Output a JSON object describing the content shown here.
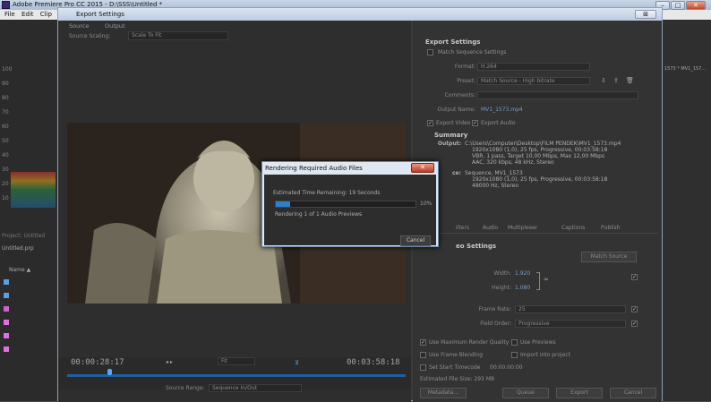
{
  "background_app": {
    "title": "Adobe Premiere Pro CC 2015 - D:\\SSS\\Untitled *",
    "menu": [
      "File",
      "Edit",
      "Clip"
    ],
    "window_controls": [
      "–",
      "□",
      "✕"
    ],
    "meter_scale": [
      "100",
      "90",
      "80",
      "70",
      "60",
      "50",
      "40",
      "30",
      "20",
      "10"
    ],
    "project": {
      "label": "Project: Untitled",
      "file": "Untitled.prp",
      "name_header": "Name ▲"
    },
    "right_seq": "1573 * MV1_157..."
  },
  "dialog": {
    "title": "Export Settings",
    "close_label": "⊠",
    "tabs": [
      "Source",
      "Output"
    ],
    "source_scaling_label": "Source Scaling:",
    "source_scaling_value": "Scale To Fit",
    "timecode_in": "00:00:28:17",
    "timecode_out": "00:03:58:18",
    "fit_value": "Fit",
    "source_range_label": "Source Range:",
    "source_range_value": "Sequence In/Out",
    "export_settings": {
      "header": "Export Settings",
      "match_sequence": "Match Sequence Settings",
      "format_label": "Format:",
      "format_value": "H.264",
      "preset_label": "Preset:",
      "preset_value": "Match Source - High bitrate",
      "comments_label": "Comments:",
      "output_name_label": "Output Name:",
      "output_name_value": "MV1_1573.mp4",
      "export_video": "Export Video",
      "export_audio": "Export Audio"
    },
    "summary": {
      "header": "Summary",
      "output_label": "Output:",
      "output_lines": [
        "C:\\Users\\Computer\\Desktop\\FILM PENDEK\\MV1_1573.mp4",
        "1920x1080 (1,0), 25 fps, Progressive, 00:03:58:18",
        "VBR, 1 pass, Target 10,00 Mbps, Max 12,00 Mbps",
        "AAC, 320 kbps, 48 kHz, Stereo"
      ],
      "source_label": "ce:",
      "source_lines": [
        "Sequence, MV1_1573",
        "1920x1080 (1,0), 25 fps, Progressive, 00:03:58:18",
        "48000 Hz, Stereo"
      ]
    },
    "settings_tabs": [
      "ilters",
      "Audio",
      "Multiplexer",
      "Captions",
      "Publish"
    ],
    "video_settings": {
      "header": "eo Settings",
      "match_source_button": "Match Source",
      "width_label": "Width:",
      "width_value": "1.920",
      "height_label": "Height:",
      "height_value": "1.080",
      "frame_rate_label": "Frame Rate:",
      "frame_rate_value": "25",
      "field_order_label": "Field Order:",
      "field_order_value": "Progressive"
    },
    "bottom": {
      "max_render_quality": "Use Maximum Render Quality",
      "use_previews": "Use Previews",
      "frame_blending": "Use Frame Blending",
      "import_into_project": "Import into project",
      "set_start_timecode": "Set Start Timecode",
      "start_timecode_value": "00:00:00:00",
      "estimated_file_size": "Estimated File Size: 293 MB",
      "metadata_button": "Metadata...",
      "queue_button": "Queue",
      "export_button": "Export",
      "cancel_button": "Cancel"
    }
  },
  "rendering_modal": {
    "title": "Rendering Required Audio Files",
    "close_label": "✕",
    "estimated_time": "Estimated Time Remaining: 19 Seconds",
    "progress_percent": 10,
    "progress_label": "10%",
    "status": "Rendering 1 of 1 Audio Previews",
    "cancel_label": "Cancel"
  },
  "colors": {
    "accent_blue": "#2e7fd0",
    "dialog_chrome": "#b9cbe1",
    "close_red": "#c0391f"
  }
}
